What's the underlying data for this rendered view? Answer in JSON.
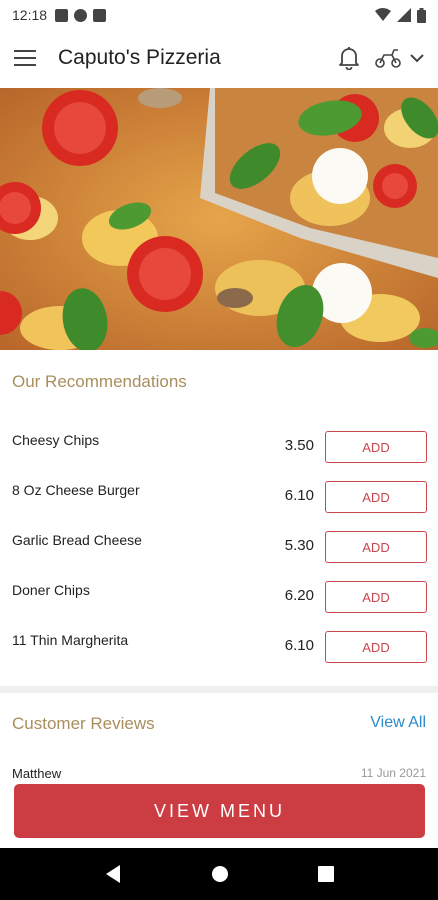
{
  "status_bar": {
    "time": "12:18"
  },
  "app_bar": {
    "title": "Caputo's Pizzeria"
  },
  "recommendations": {
    "title": "Our Recommendations",
    "items": [
      {
        "name": "Cheesy Chips",
        "price": "3.50",
        "button": "ADD"
      },
      {
        "name": "8 Oz Cheese Burger",
        "price": "6.10",
        "button": "ADD"
      },
      {
        "name": "Garlic Bread Cheese",
        "price": "5.30",
        "button": "ADD"
      },
      {
        "name": "Doner Chips",
        "price": "6.20",
        "button": "ADD"
      },
      {
        "name": "11 Thin Margherita",
        "price": "6.10",
        "button": "ADD"
      }
    ]
  },
  "reviews": {
    "title": "Customer Reviews",
    "view_all": "View All",
    "first_reviewer": "Matthew",
    "first_date": "11 Jun 2021"
  },
  "cta": {
    "label": "VIEW MENU"
  },
  "colors": {
    "accent": "#cc3d43",
    "section_title": "#a98e5e",
    "link": "#2b8ac8"
  },
  "icons": [
    "menu-icon",
    "bell-icon",
    "scooter-icon",
    "chevron-down-icon",
    "back-icon",
    "home-icon",
    "recents-icon"
  ]
}
